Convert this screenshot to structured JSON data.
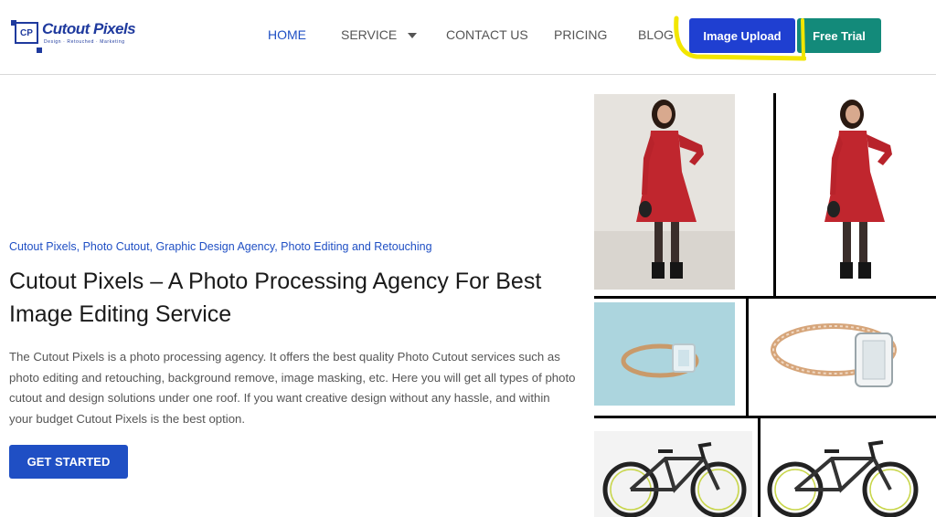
{
  "brand": {
    "name": "Cutout Pixels",
    "mark": "CP",
    "tagline": "Design · Retouched · Marketing",
    "color": "#1f3a9e"
  },
  "nav": {
    "home": "HOME",
    "service": "SERVICE",
    "contact": "CONTACT US",
    "pricing": "PRICING",
    "blog": "BLOG",
    "image_upload": "Image Upload",
    "free_trial": "Free Trial"
  },
  "hero": {
    "categories": "Cutout Pixels, Photo Cutout, Graphic Design Agency, Photo Editing and Retouching",
    "title": "Cutout Pixels – A Photo Processing Agency For Best Image Editing Service",
    "body": "The Cutout Pixels is a photo processing agency. It offers the best quality Photo Cutout services such as photo editing and retouching, background remove, image masking, etc. Here you will get all types of photo cutout and design solutions under one roof. If you want creative design without any hassle, and within your budget Cutout Pixels is the best option.",
    "cta": "GET STARTED"
  },
  "colors": {
    "accent": "#1f4fc4",
    "upload_button": "#1f3fd1",
    "trial_button": "#138a7a",
    "highlight": "#f2e600"
  },
  "gallery": {
    "items": [
      {
        "name": "woman-red-dress-original"
      },
      {
        "name": "woman-red-dress-cutout"
      },
      {
        "name": "ring-original"
      },
      {
        "name": "ring-cutout"
      },
      {
        "name": "bicycle-original"
      },
      {
        "name": "bicycle-cutout"
      }
    ]
  }
}
